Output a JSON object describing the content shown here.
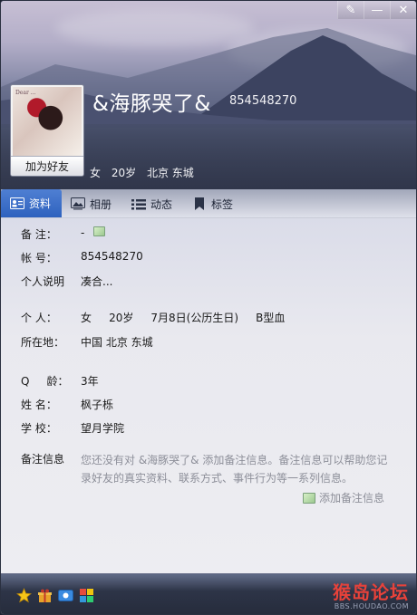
{
  "window": {
    "controls": [
      "skin-icon",
      "minimize-icon",
      "close-icon"
    ]
  },
  "profile": {
    "nickname": "&海豚哭了&",
    "qq_number": "854548270",
    "add_friend_label": "加为好友",
    "basic_info": [
      "女",
      "20岁",
      "北京 东城"
    ],
    "avatar_caption": "Dear ..."
  },
  "tabs": [
    {
      "label": "资料",
      "icon": "profile-card-icon",
      "active": true
    },
    {
      "label": "相册",
      "icon": "album-icon",
      "active": false
    },
    {
      "label": "动态",
      "icon": "feed-list-icon",
      "active": false
    },
    {
      "label": "标签",
      "icon": "bookmark-tag-icon",
      "active": false
    }
  ],
  "details": {
    "remark": {
      "label": "备    注：",
      "value": "-"
    },
    "account": {
      "label": "帐    号：",
      "value": "854548270"
    },
    "description": {
      "label": "个人说明",
      "value": "凑合..."
    },
    "person": {
      "label": "个    人：",
      "value": "女     20岁     7月8日(公历生日)     B型血"
    },
    "location": {
      "label": "所在地：",
      "value": "中国 北京 东城"
    },
    "q_age": {
      "label": "Q     龄：",
      "value": "3年"
    },
    "name": {
      "label": "姓    名：",
      "value": "枫子栎"
    },
    "school": {
      "label": "学    校：",
      "value": "望月学院"
    }
  },
  "notes": {
    "label": "备注信息",
    "text": "您还没有对 &海豚哭了& 添加备注信息。备注信息可以帮助您记录好友的真实资料、联系方式、事件行为等一系列信息。",
    "add_link": "添加备注信息"
  },
  "bottombar": {
    "icons": [
      "star-icon",
      "gift-icon",
      "mail-icon",
      "apps-icon"
    ],
    "watermark_main": "猴岛论坛",
    "watermark_sub": "BBS.HOUDAO.COM"
  },
  "colors": {
    "tab_active": "#2e62be",
    "note_text": "#8d8f99",
    "watermark": "#e8423a"
  }
}
